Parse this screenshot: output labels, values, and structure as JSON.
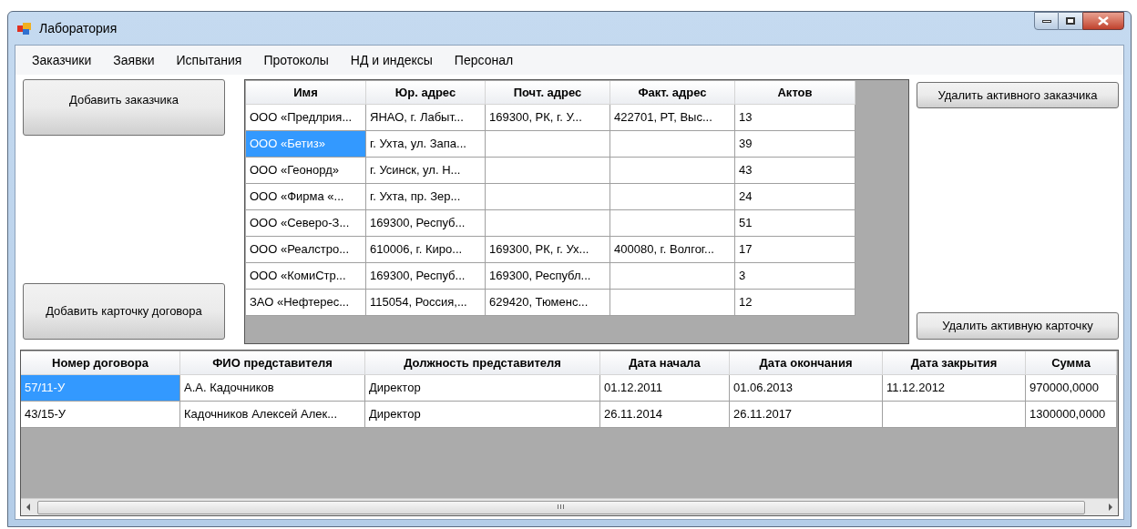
{
  "window": {
    "title": "Лаборатория"
  },
  "menu": [
    "Заказчики",
    "Заявки",
    "Испытания",
    "Протоколы",
    "НД и индексы",
    "Персонал"
  ],
  "left_buttons": [
    "Добавить заказчика",
    "Добавить карточку договора"
  ],
  "right_buttons": [
    "Удалить активного заказчика",
    "Удалить активную карточку"
  ],
  "customers": {
    "columns": [
      "Имя",
      "Юр. адрес",
      "Почт. адрес",
      "Факт. адрес",
      "Актов"
    ],
    "rows": [
      {
        "selected": false,
        "cells": [
          "ООО «Предлрия...",
          "ЯНАО, г. Лабыт...",
          "169300, РК,  г. У...",
          "422701, РТ, Выс...",
          "13"
        ]
      },
      {
        "selected": true,
        "cells": [
          "ООО «Бетиз»",
          "г. Ухта, ул. Запа...",
          "",
          "",
          "39"
        ]
      },
      {
        "selected": false,
        "cells": [
          "ООО «Геонорд»",
          "г. Усинск, ул. Н...",
          "",
          "",
          "43"
        ]
      },
      {
        "selected": false,
        "cells": [
          "ООО «Фирма «...",
          "г. Ухта, пр. Зер...",
          "",
          "",
          "24"
        ]
      },
      {
        "selected": false,
        "cells": [
          "ООО «Северо-З...",
          "169300, Респуб...",
          "",
          "",
          "51"
        ]
      },
      {
        "selected": false,
        "cells": [
          "ООО «Реалстро...",
          "610006, г. Киро...",
          "169300, РК, г. Ух...",
          "400080, г. Волгог...",
          "17"
        ]
      },
      {
        "selected": false,
        "cells": [
          "ООО «КомиСтр...",
          "169300, Респуб...",
          "169300, Республ...",
          "",
          "3"
        ]
      },
      {
        "selected": false,
        "cells": [
          "ЗАО «Нефтерес...",
          "115054, Россия,...",
          "629420, Тюменс...",
          "",
          "12"
        ]
      }
    ]
  },
  "contracts": {
    "columns": [
      "Номер договора",
      "ФИО представителя",
      "Должность представителя",
      "Дата начала",
      "Дата окончания",
      "Дата закрытия",
      "Сумма"
    ],
    "rows": [
      {
        "selected": true,
        "cells": [
          "57/11-У",
          "А.А. Кадочников",
          "Директор",
          "01.12.2011",
          "01.06.2013",
          "11.12.2012",
          "970000,0000"
        ]
      },
      {
        "selected": false,
        "cells": [
          "43/15-У",
          "Кадочников Алексей Алек...",
          "Директор",
          "26.11.2014",
          "26.11.2017",
          "",
          "1300000,0000"
        ]
      }
    ]
  },
  "scrollbar": {
    "thumb_glyph": "III"
  }
}
